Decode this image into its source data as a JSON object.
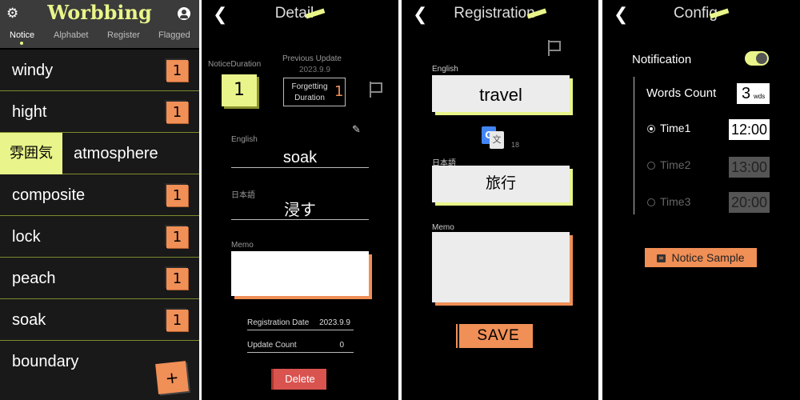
{
  "list_screen": {
    "app_title": "Worbbing",
    "tabs": [
      {
        "label": "Notice",
        "active": true
      },
      {
        "label": "Alphabet"
      },
      {
        "label": "Register"
      },
      {
        "label": "Flagged"
      }
    ],
    "rows": [
      {
        "word": "windy",
        "count": "1"
      },
      {
        "word": "hight",
        "count": "1"
      },
      {
        "japanese": "雰囲気",
        "word": "atmosphere"
      },
      {
        "word": "composite",
        "count": "1"
      },
      {
        "word": "lock",
        "count": "1"
      },
      {
        "word": "peach",
        "count": "1"
      },
      {
        "word": "soak",
        "count": "1"
      },
      {
        "word": "boundary"
      }
    ],
    "add_label": "+"
  },
  "detail_screen": {
    "title": "Detail",
    "notice_duration_label": "NoticeDuration",
    "notice_duration_value": "1",
    "previous_update_label": "Previous Update",
    "previous_update_value": "2023.9.9",
    "forgetting_duration_label": "Forgetting Duration",
    "forgetting_duration_value": "1",
    "english_label": "English",
    "english_value": "soak",
    "japanese_label": "日本語",
    "japanese_value": "浸す",
    "memo_label": "Memo",
    "registration_date_label": "Registration Date",
    "registration_date_value": "2023.9.9",
    "update_count_label": "Update Count",
    "update_count_value": "0",
    "delete_label": "Delete"
  },
  "registration_screen": {
    "title": "Registration",
    "english_label": "English",
    "english_value": "travel",
    "translate_count": "18",
    "japanese_label": "日本語",
    "japanese_value": "旅行",
    "memo_label": "Memo",
    "save_label": "SAVE"
  },
  "config_screen": {
    "title": "Config",
    "notification_label": "Notification",
    "notification_on": true,
    "words_count_label": "Words Count",
    "words_count_value": "3",
    "words_count_unit": "wds",
    "times": [
      {
        "label": "Time1",
        "value": "12:00",
        "selected": true
      },
      {
        "label": "Time2",
        "value": "13:00",
        "selected": false
      },
      {
        "label": "Time3",
        "value": "20:00",
        "selected": false
      }
    ],
    "notice_sample_label": "Notice Sample"
  },
  "colors": {
    "accent_yellow": "#e9f58a",
    "accent_orange": "#f08f56",
    "delete_red": "#d9534f",
    "background": "#000000"
  },
  "icons": [
    "gear-icon",
    "account-icon",
    "back-icon",
    "flag-icon",
    "pencil-icon",
    "google-translate-icon",
    "notification-icon"
  ]
}
